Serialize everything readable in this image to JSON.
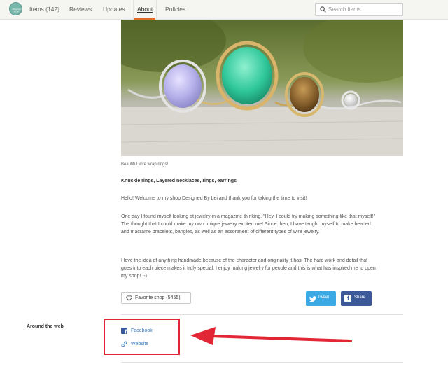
{
  "nav": {
    "items": [
      "Items (142)",
      "Reviews",
      "Updates"
    ],
    "active": "About",
    "policies": "Policies",
    "search_placeholder": "Search items"
  },
  "photo": {
    "caption": "Beautiful wire wrap rings!"
  },
  "about": {
    "tagline": "Knuckle rings, Layered necklaces, rings, earrings",
    "paragraphs": [
      "Hello! Welcome to my shop Designed By Lei and thank you for taking the time to visit!",
      "One day I found myself looking at jewelry in a magazine thinking, \"Hey, I could try making something like that myself!\" The thought that I could make my own unique jewelry excited me! Since then, I have taught myself to make beaded and macrame bracelets, bangles, as well as an assortment of different types of wire jewelry.",
      "I love the idea of anything handmade because of the character and originality it has. The hard work and detail that goes into each piece makes it truly special. I enjoy making jewelry for people and this is what has inspired me to open my shop! :-)"
    ]
  },
  "actions": {
    "favorite_label": "Favorite shop (5455)",
    "tweet_label": "Tweet",
    "share_label": "Share"
  },
  "around_web": {
    "heading": "Around the web",
    "links": [
      "Facebook",
      "Website"
    ]
  },
  "colors": {
    "accent_tab": "#e06a26",
    "link": "#3b7bbf",
    "twitter": "#3aa9e4",
    "facebook": "#3b5998",
    "highlight": "#e32636"
  }
}
